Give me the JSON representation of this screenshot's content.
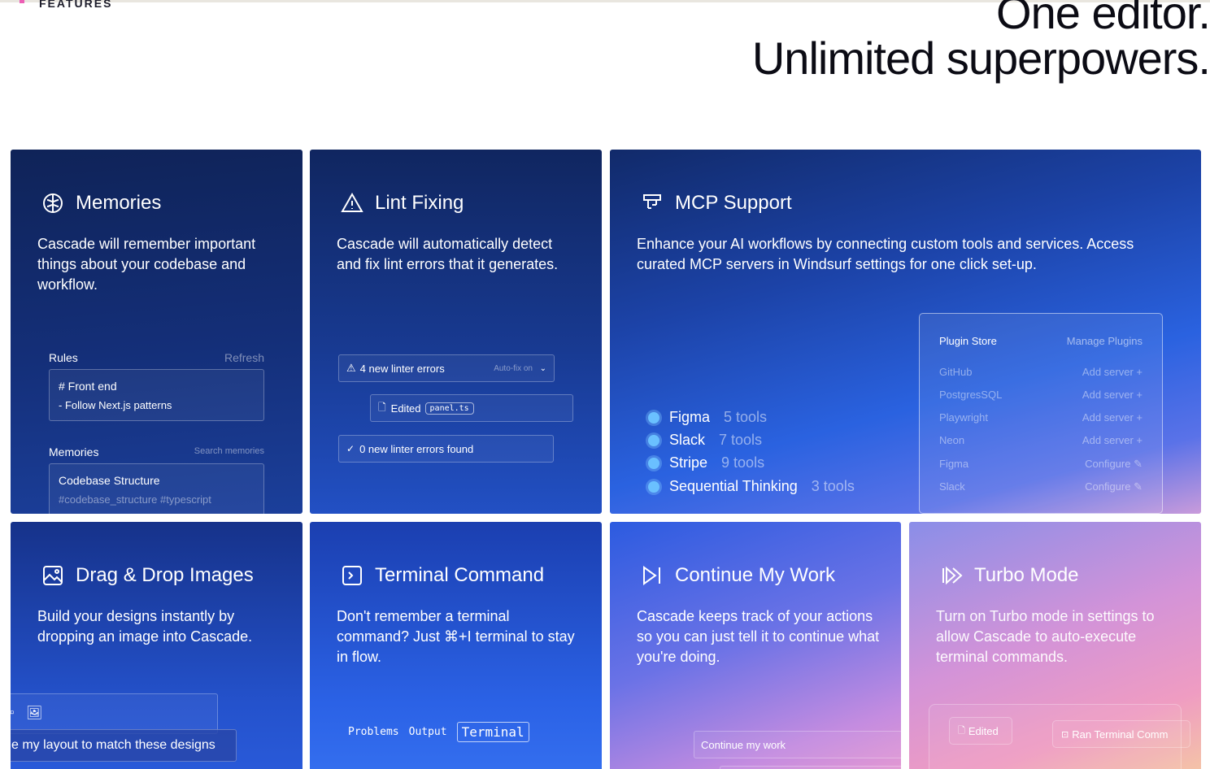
{
  "section": {
    "label": "FEATURES"
  },
  "headline": {
    "line1": "One editor.",
    "line2": "Unlimited superpowers."
  },
  "memories": {
    "title": "Memories",
    "description": "Cascade will remember important things about your codebase and workflow.",
    "rules_label": "Rules",
    "refresh_label": "Refresh",
    "rules_line1": "# Front end",
    "rules_line2": "- Follow Next.js patterns",
    "memories_label": "Memories",
    "search_label": "Search memories",
    "memory_title": "Codebase Structure",
    "memory_tags": "#codebase_structure #typescript"
  },
  "lint": {
    "title": "Lint Fixing",
    "description": "Cascade will automatically detect and fix lint errors that it generates.",
    "errors_label": "4 new linter errors",
    "autofix_label": "Auto-fix on",
    "edited_label": "Edited",
    "file_badge": "panel.ts",
    "found_label": "0 new linter errors found"
  },
  "mcp": {
    "title": "MCP Support",
    "description": "Enhance your AI workflows by connecting custom tools and services. Access curated MCP servers in Windsurf settings for one click set-up.",
    "tools": [
      {
        "name": "Figma",
        "count": "5 tools"
      },
      {
        "name": "Slack",
        "count": "7 tools"
      },
      {
        "name": "Stripe",
        "count": "9 tools"
      },
      {
        "name": "Sequential Thinking",
        "count": "3 tools"
      }
    ],
    "store": {
      "title": "Plugin Store",
      "manage": "Manage Plugins",
      "rows": [
        {
          "name": "GitHub",
          "action": "Add server +"
        },
        {
          "name": "PostgresSQL",
          "action": "Add server +"
        },
        {
          "name": "Playwright",
          "action": "Add server +"
        },
        {
          "name": "Neon",
          "action": "Add server +"
        },
        {
          "name": "Figma",
          "action": "Configure"
        },
        {
          "name": "Slack",
          "action": "Configure"
        }
      ]
    }
  },
  "drag": {
    "title": "Drag & Drop Images",
    "description": "Build your designs instantly by dropping an image into Cascade.",
    "prompt": "e my layout to match these designs"
  },
  "terminal": {
    "title": "Terminal Command",
    "description": "Don't remember a terminal command? Just ⌘+I terminal to stay in flow.",
    "tabs": [
      "Problems",
      "Output",
      "Terminal"
    ]
  },
  "continue": {
    "title": "Continue My Work",
    "description": "Cascade keeps track of your actions so you can just tell it to continue what you're doing.",
    "button": "Continue my work"
  },
  "turbo": {
    "title": "Turbo Mode",
    "description": "Turn on Turbo mode in settings to allow Cascade to auto-execute terminal commands.",
    "edited": "Edited",
    "ran": "Ran Terminal Comm"
  }
}
